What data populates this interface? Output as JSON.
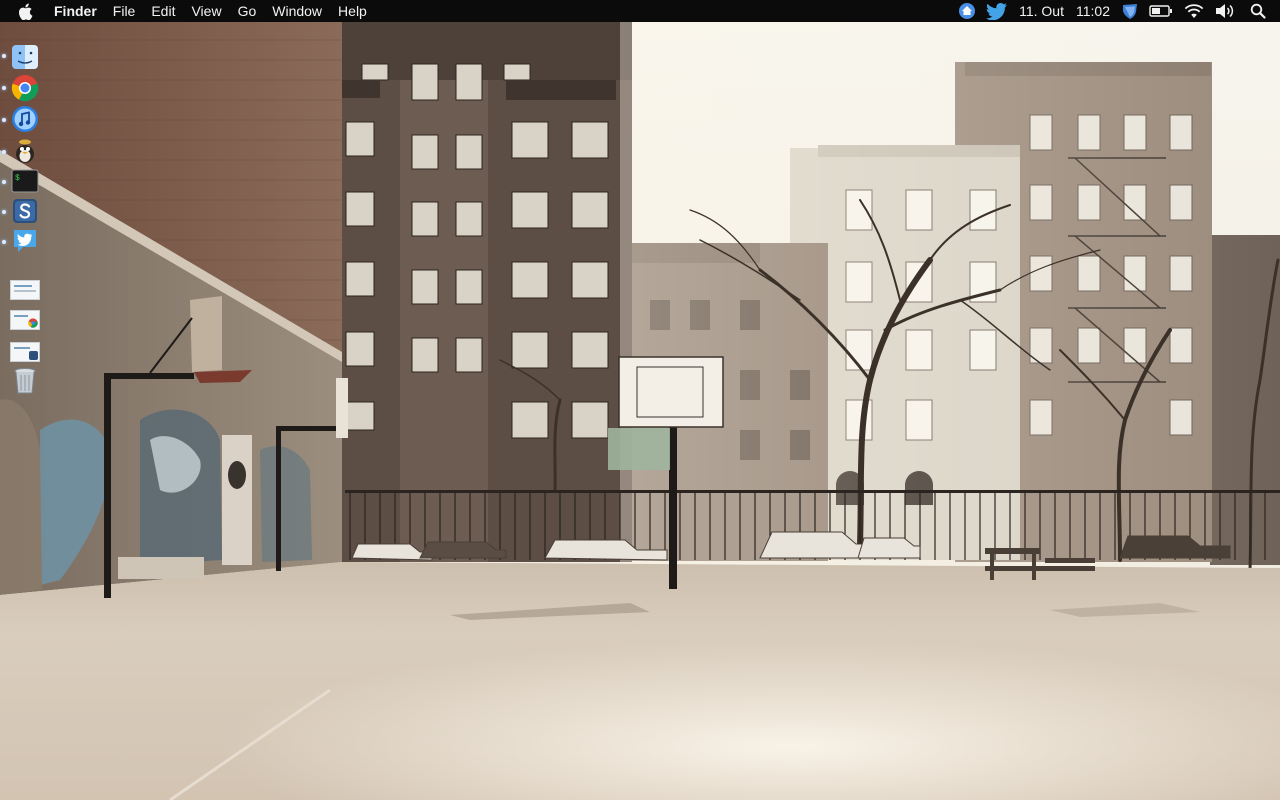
{
  "menubar": {
    "app_name": "Finder",
    "menus": [
      "File",
      "Edit",
      "View",
      "Go",
      "Window",
      "Help"
    ],
    "status_icons": [
      "home-status-icon",
      "twitter-status-icon",
      "shield-status-icon",
      "battery-icon",
      "wifi-icon",
      "volume-icon",
      "spotlight-search-icon"
    ],
    "date": "11. Out",
    "time": "11:02"
  },
  "dock": {
    "apps": [
      "finder-icon",
      "chrome-icon",
      "itunes-icon",
      "adium-icon",
      "terminal-icon",
      "simplenote-icon",
      "twitter-icon"
    ],
    "minimized": [
      "minimized-window-1",
      "minimized-window-2-chrome",
      "minimized-window-3-simplenote"
    ],
    "trash": "trash-icon"
  },
  "colors": {
    "menubar_bg": "#0b0b0b",
    "menubar_text": "#f2f2f2",
    "sky": "#f3f0e6",
    "ground": "#d9ccbb"
  }
}
